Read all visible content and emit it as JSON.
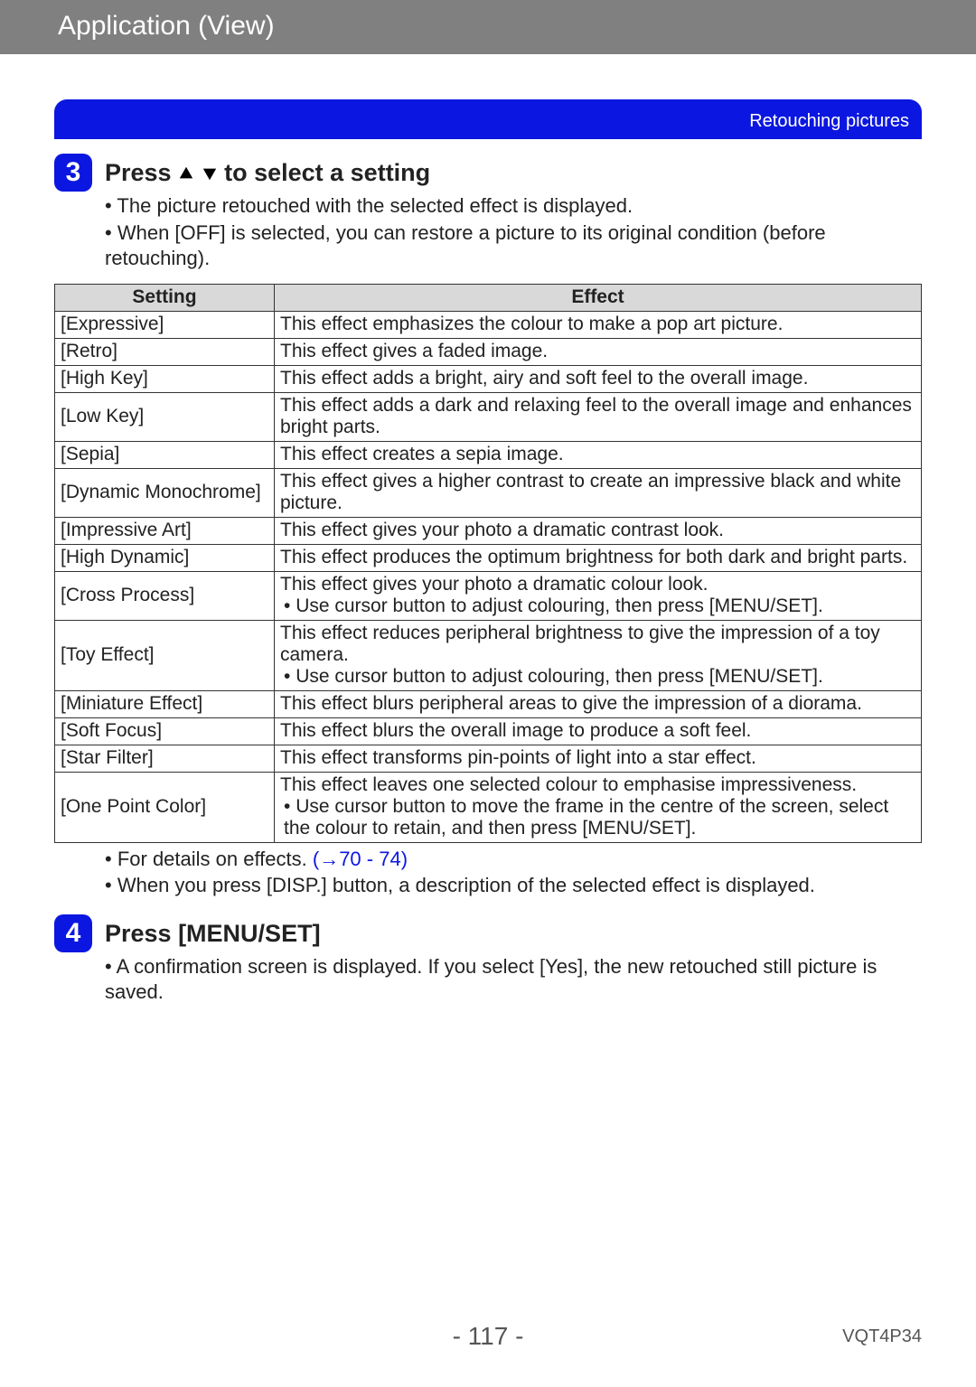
{
  "header": {
    "title": "Application (View)",
    "breadcrumb": "Retouching pictures"
  },
  "step3": {
    "num": "3",
    "title_prefix": "Press ",
    "title_suffix": " to select a setting",
    "bullets": [
      "The picture retouched with the selected effect is displayed.",
      "When [OFF] is selected, you can restore a picture to its original condition (before retouching)."
    ]
  },
  "table": {
    "headers": {
      "setting": "Setting",
      "effect": "Effect"
    },
    "rows": [
      {
        "setting": "[Expressive]",
        "effect": "This effect emphasizes the colour to make a pop art picture."
      },
      {
        "setting": "[Retro]",
        "effect": "This effect gives a faded image."
      },
      {
        "setting": "[High Key]",
        "effect": "This effect adds a bright, airy and soft feel to the overall image."
      },
      {
        "setting": "[Low Key]",
        "effect": "This effect adds a dark and relaxing feel to the overall image and enhances bright parts."
      },
      {
        "setting": "[Sepia]",
        "effect": "This effect creates a sepia image."
      },
      {
        "setting": "[Dynamic Monochrome]",
        "effect": "This effect gives a higher contrast to create an impressive black and white picture."
      },
      {
        "setting": "[Impressive Art]",
        "effect": "This effect gives your photo a dramatic contrast look."
      },
      {
        "setting": "[High Dynamic]",
        "effect": "This effect produces the optimum brightness for both dark and bright parts."
      },
      {
        "setting": "[Cross Process]",
        "effect": "This effect gives your photo a dramatic colour look.",
        "sub": "Use cursor button to adjust colouring, then press [MENU/SET]."
      },
      {
        "setting": "[Toy Effect]",
        "effect": "This effect reduces peripheral brightness to give the impression of a toy camera.",
        "sub": "Use cursor button to adjust colouring, then press [MENU/SET]."
      },
      {
        "setting": "[Miniature Effect]",
        "effect": "This effect blurs peripheral areas to give the impression of a diorama."
      },
      {
        "setting": "[Soft Focus]",
        "effect": "This effect blurs the overall image to produce a soft feel."
      },
      {
        "setting": "[Star Filter]",
        "effect": "This effect transforms pin-points of light into a star effect."
      },
      {
        "setting": "[One Point Color]",
        "effect": "This effect leaves one selected colour to emphasise impressiveness.",
        "sub": "Use cursor button to move the frame in the centre of the screen, select the colour to retain, and then press [MENU/SET]."
      }
    ]
  },
  "after_table": {
    "line1_prefix": "For details on effects. ",
    "line1_link": "(→70 - 74)",
    "line2": "When you press [DISP.] button, a description of the selected effect is displayed."
  },
  "step4": {
    "num": "4",
    "title": "Press [MENU/SET]",
    "bullets": [
      "A confirmation screen is displayed. If you select [Yes], the new retouched still picture is saved."
    ]
  },
  "footer": {
    "page": "- 117 -",
    "doc": "VQT4P34"
  }
}
